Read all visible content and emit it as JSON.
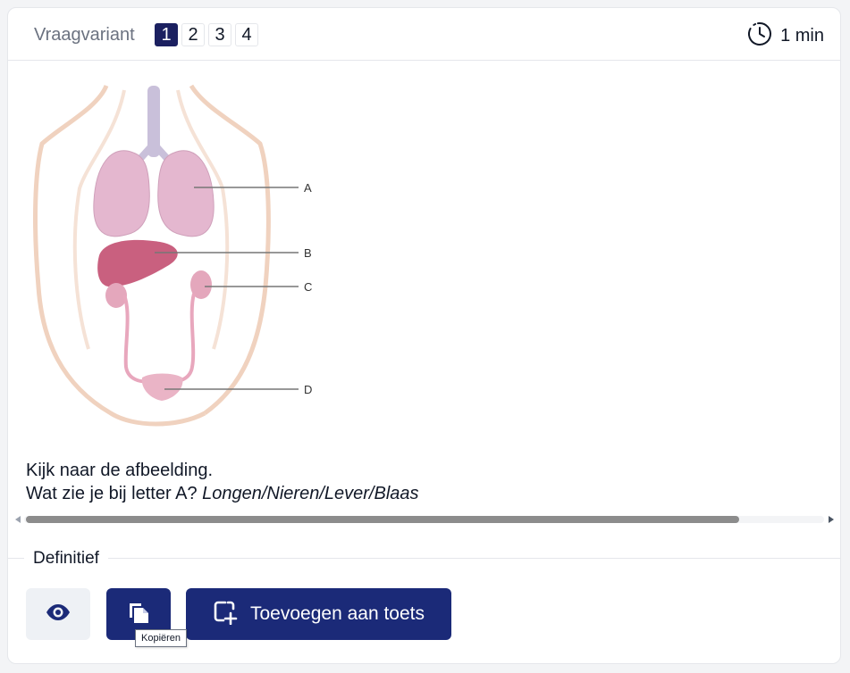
{
  "header": {
    "variant_label": "Vraagvariant",
    "variants": [
      "1",
      "2",
      "3",
      "4"
    ],
    "active_variant": "1",
    "duration": "1 min"
  },
  "figure": {
    "labels": [
      "A",
      "B",
      "C",
      "D"
    ]
  },
  "question": {
    "line1": "Kijk naar de afbeelding.",
    "line2_prefix": "Wat zie je bij letter A? ",
    "line2_options": "Longen/Nieren/Lever/Blaas"
  },
  "status": {
    "label": "Definitief"
  },
  "actions": {
    "view_icon": "eye-icon",
    "copy_icon": "copy-icon",
    "add_icon": "add-to-test-icon",
    "add_label": "Toevoegen aan toets",
    "copy_tooltip": "Kopiëren"
  },
  "colors": {
    "primary": "#1b2a78",
    "active_variant": "#1b2060",
    "muted_button": "#eef1f5"
  }
}
